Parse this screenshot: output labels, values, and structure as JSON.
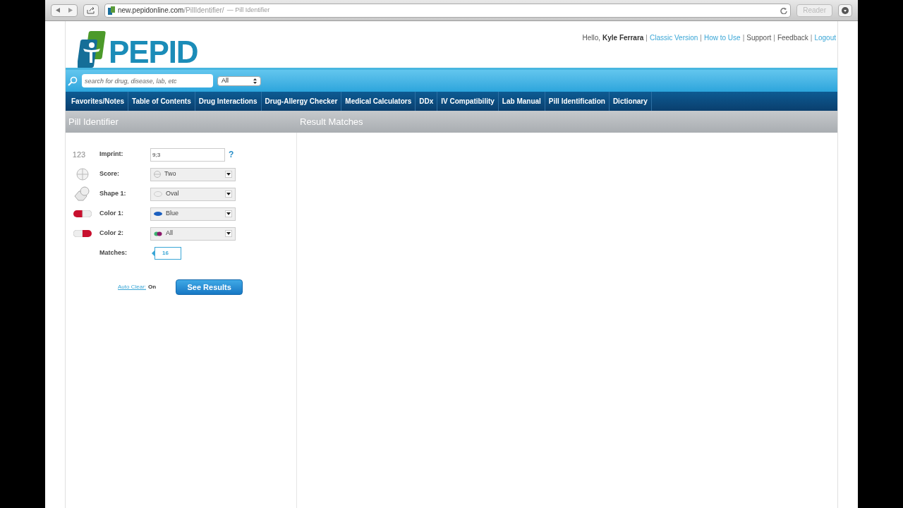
{
  "browser": {
    "url_host": "new.pepidonline.com",
    "url_path": "/PillIdentifier/",
    "page_title": "— Pill Identifier",
    "reader": "Reader"
  },
  "header": {
    "logo": "PEPID",
    "greeting": "Hello,",
    "user": "Kyle Ferrara",
    "separator": "|",
    "links": [
      {
        "label": "Classic Version",
        "kind": "link"
      },
      {
        "label": "How to Use",
        "kind": "link"
      },
      {
        "label": "Support",
        "kind": "plain"
      },
      {
        "label": "Feedback",
        "kind": "plain"
      },
      {
        "label": "Logout",
        "kind": "link"
      }
    ]
  },
  "search": {
    "placeholder": "search for drug, disease, lab, etc",
    "scope": "All"
  },
  "nav": [
    "Favorites/Notes",
    "Table of Contents",
    "Drug Interactions",
    "Drug-Allergy Checker",
    "Medical Calculators",
    "DDx",
    "IV Compatibility",
    "Lab Manual",
    "Pill Identification",
    "Dictionary"
  ],
  "left_title": "Pill Identifier",
  "right_title": "Result Matches",
  "fields": [
    {
      "kind": "text",
      "icon_text": "123",
      "label": "Imprint:",
      "value": "9;3",
      "help": "?"
    },
    {
      "kind": "select",
      "label": "Score:",
      "value": "Two"
    },
    {
      "kind": "select",
      "label": "Shape 1:",
      "value": "Oval"
    },
    {
      "kind": "select",
      "label": "Color 1:",
      "value": "Blue"
    },
    {
      "kind": "select",
      "label": "Color 2:",
      "value": "All"
    },
    {
      "kind": "count",
      "label": "Matches:",
      "value": "16"
    }
  ],
  "auto_clear": {
    "label": "Auto Clear:",
    "state": "On"
  },
  "submit": "See Results"
}
